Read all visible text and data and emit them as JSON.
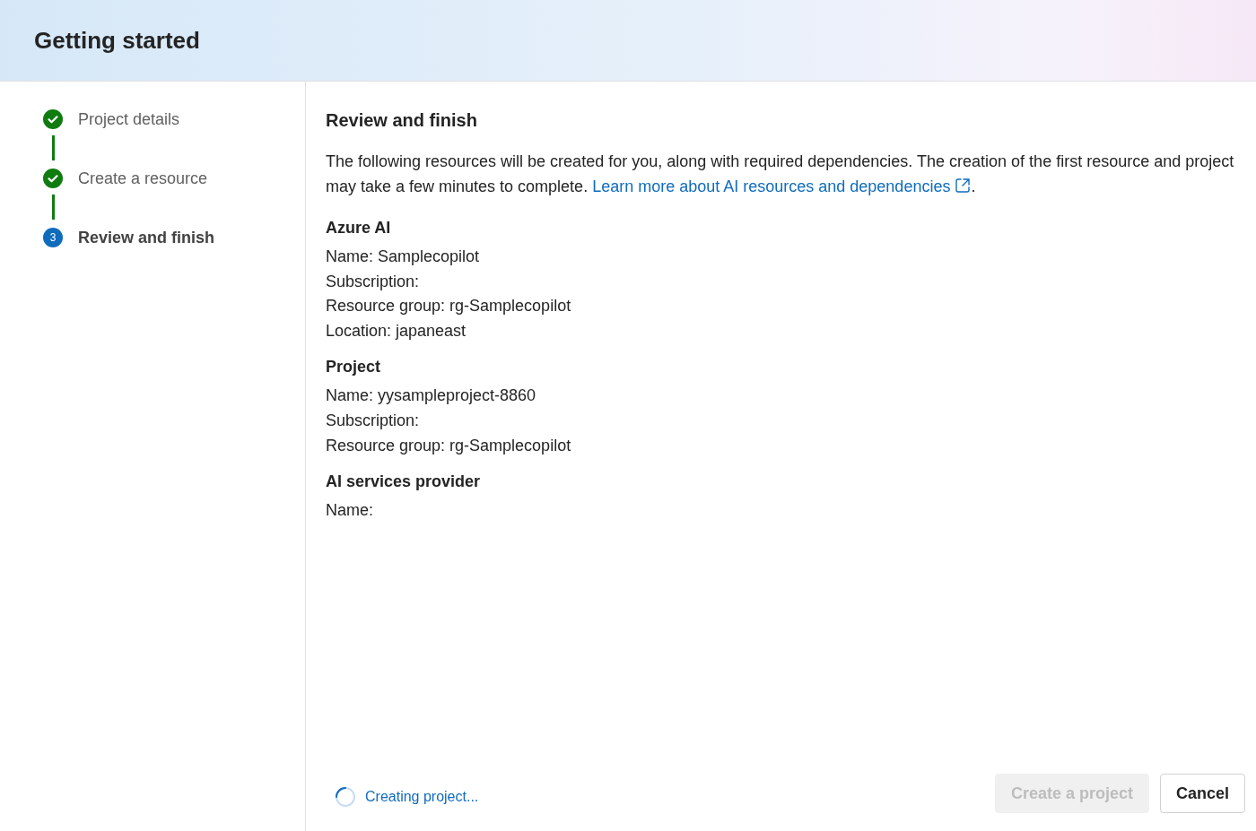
{
  "header": {
    "title": "Getting started"
  },
  "steps": [
    {
      "label": "Project details",
      "kind": "done",
      "selected": false
    },
    {
      "label": "Create a resource",
      "kind": "done",
      "selected": false
    },
    {
      "label": "Review and finish",
      "kind": "current",
      "number": "3",
      "selected": true
    }
  ],
  "main": {
    "heading": "Review and finish",
    "intro": "The following resources will be created for you, along with required dependencies. The creation of the first resource and project may take a few minutes to complete.",
    "link": "Learn more about AI resources and dependencies",
    "after_link": ".",
    "sections": [
      {
        "title": "Azure AI",
        "lines": [
          "Name: Samplecopilot",
          "Subscription:",
          "Resource group: rg-Samplecopilot",
          "Location: japaneast"
        ]
      },
      {
        "title": "Project",
        "lines": [
          "Name: yysampleproject-8860",
          "Subscription:",
          "Resource group: rg-Samplecopilot"
        ]
      },
      {
        "title": "AI services provider",
        "lines": [
          "Name:"
        ]
      }
    ]
  },
  "footer": {
    "status": "Creating project...",
    "buttons": [
      {
        "label": "Create a project",
        "disabled": true
      },
      {
        "label": "Cancel",
        "disabled": false
      }
    ]
  }
}
